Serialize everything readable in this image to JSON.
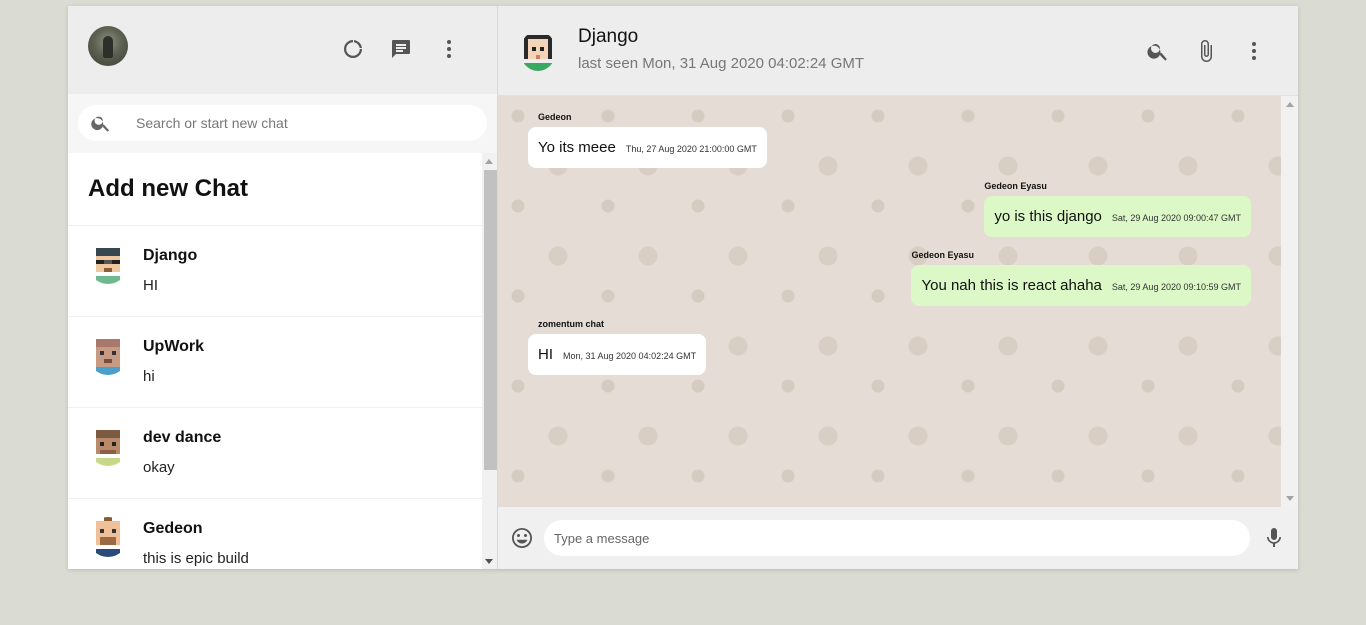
{
  "sidebar": {
    "search_placeholder": "Search or start new chat",
    "add_chat_label": "Add new Chat",
    "chats": [
      {
        "name": "Django",
        "last_message": "HI"
      },
      {
        "name": "UpWork",
        "last_message": "hi"
      },
      {
        "name": "dev dance",
        "last_message": "okay"
      },
      {
        "name": "Gedeon",
        "last_message": "this is epic build"
      }
    ]
  },
  "chat": {
    "name": "Django",
    "status": "last seen Mon, 31 Aug 2020 04:02:24 GMT",
    "messages": [
      {
        "sender": "Gedeon",
        "text": "Yo its meee",
        "timestamp": "Thu, 27 Aug 2020 21:00:00 GMT",
        "mine": false
      },
      {
        "sender": "Gedeon Eyasu",
        "text": "yo is this django",
        "timestamp": "Sat, 29 Aug 2020 09:00:47 GMT",
        "mine": true
      },
      {
        "sender": "Gedeon Eyasu",
        "text": "You nah this is react ahaha",
        "timestamp": "Sat, 29 Aug 2020 09:10:59 GMT",
        "mine": true
      },
      {
        "sender": "zomentum chat",
        "text": "HI",
        "timestamp": "Mon, 31 Aug 2020 04:02:24 GMT",
        "mine": false
      }
    ],
    "input_placeholder": "Type a message"
  },
  "colors": {
    "background": "#dadbd3",
    "header": "#ededed",
    "chat_bg": "#e5ddd5",
    "my_bubble": "#dcf8c6",
    "their_bubble": "#ffffff"
  },
  "icons": [
    "status-icon",
    "new-chat-icon",
    "more-vert-icon",
    "search-icon",
    "attach-icon",
    "emoji-icon",
    "mic-icon"
  ]
}
